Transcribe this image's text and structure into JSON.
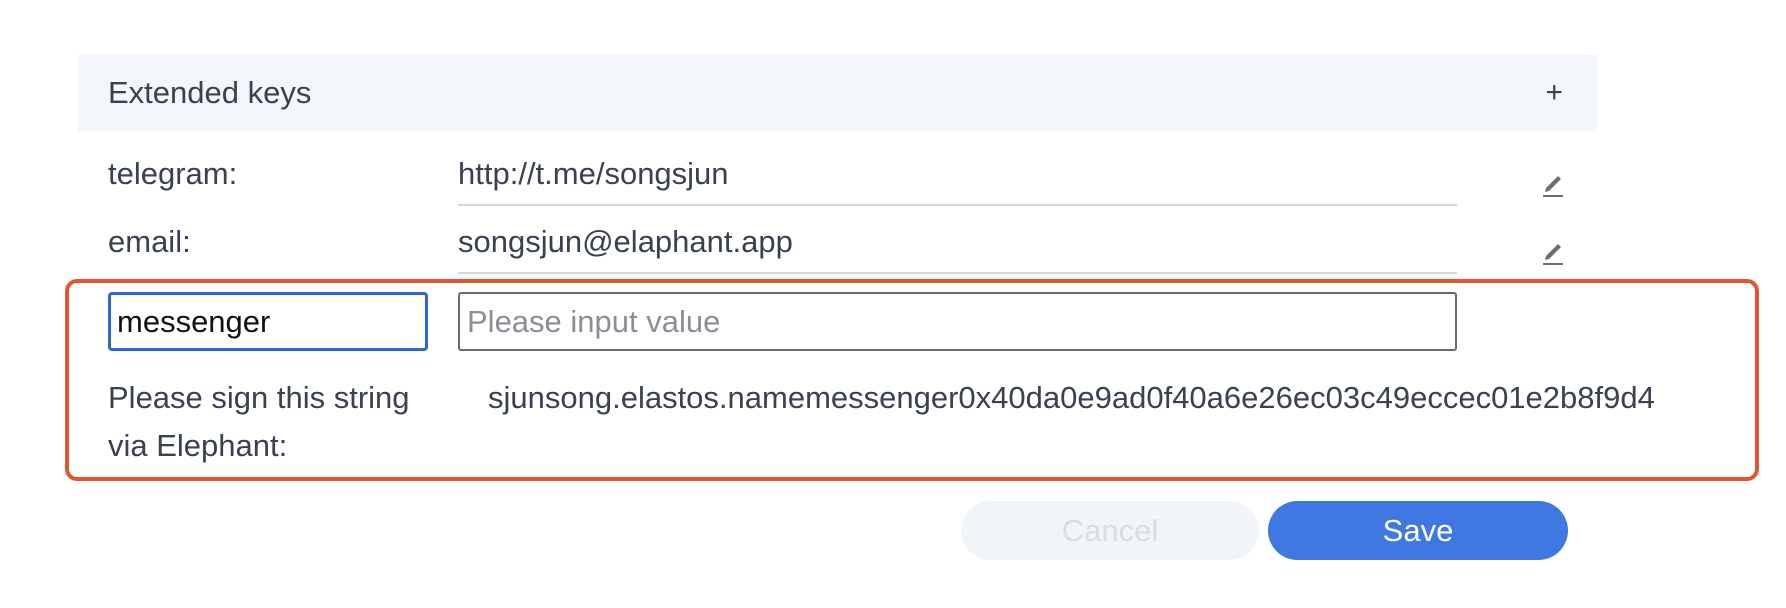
{
  "extended_keys": {
    "title": "Extended keys",
    "add_symbol": "+"
  },
  "entries": [
    {
      "key": "telegram:",
      "value": "http://t.me/songsjun",
      "edit_icon": "pencil-icon"
    },
    {
      "key": "email:",
      "value": "songsjun@elaphant.app",
      "edit_icon": "pencil-icon"
    }
  ],
  "new_entry": {
    "key_value": "messenger",
    "value_placeholder": "Please input value",
    "value": ""
  },
  "signing": {
    "label": "Please sign this string via Elephant:",
    "string": "sjunsong.elastos.namemessenger0x40da0e9ad0f40a6e26ec03c49eccec01e2b8f9d4"
  },
  "actions": {
    "cancel_label": "Cancel",
    "save_label": "Save"
  },
  "colors": {
    "highlight_border": "#e4552f",
    "primary": "#3f78e0",
    "focus_border": "#2e66d1"
  }
}
